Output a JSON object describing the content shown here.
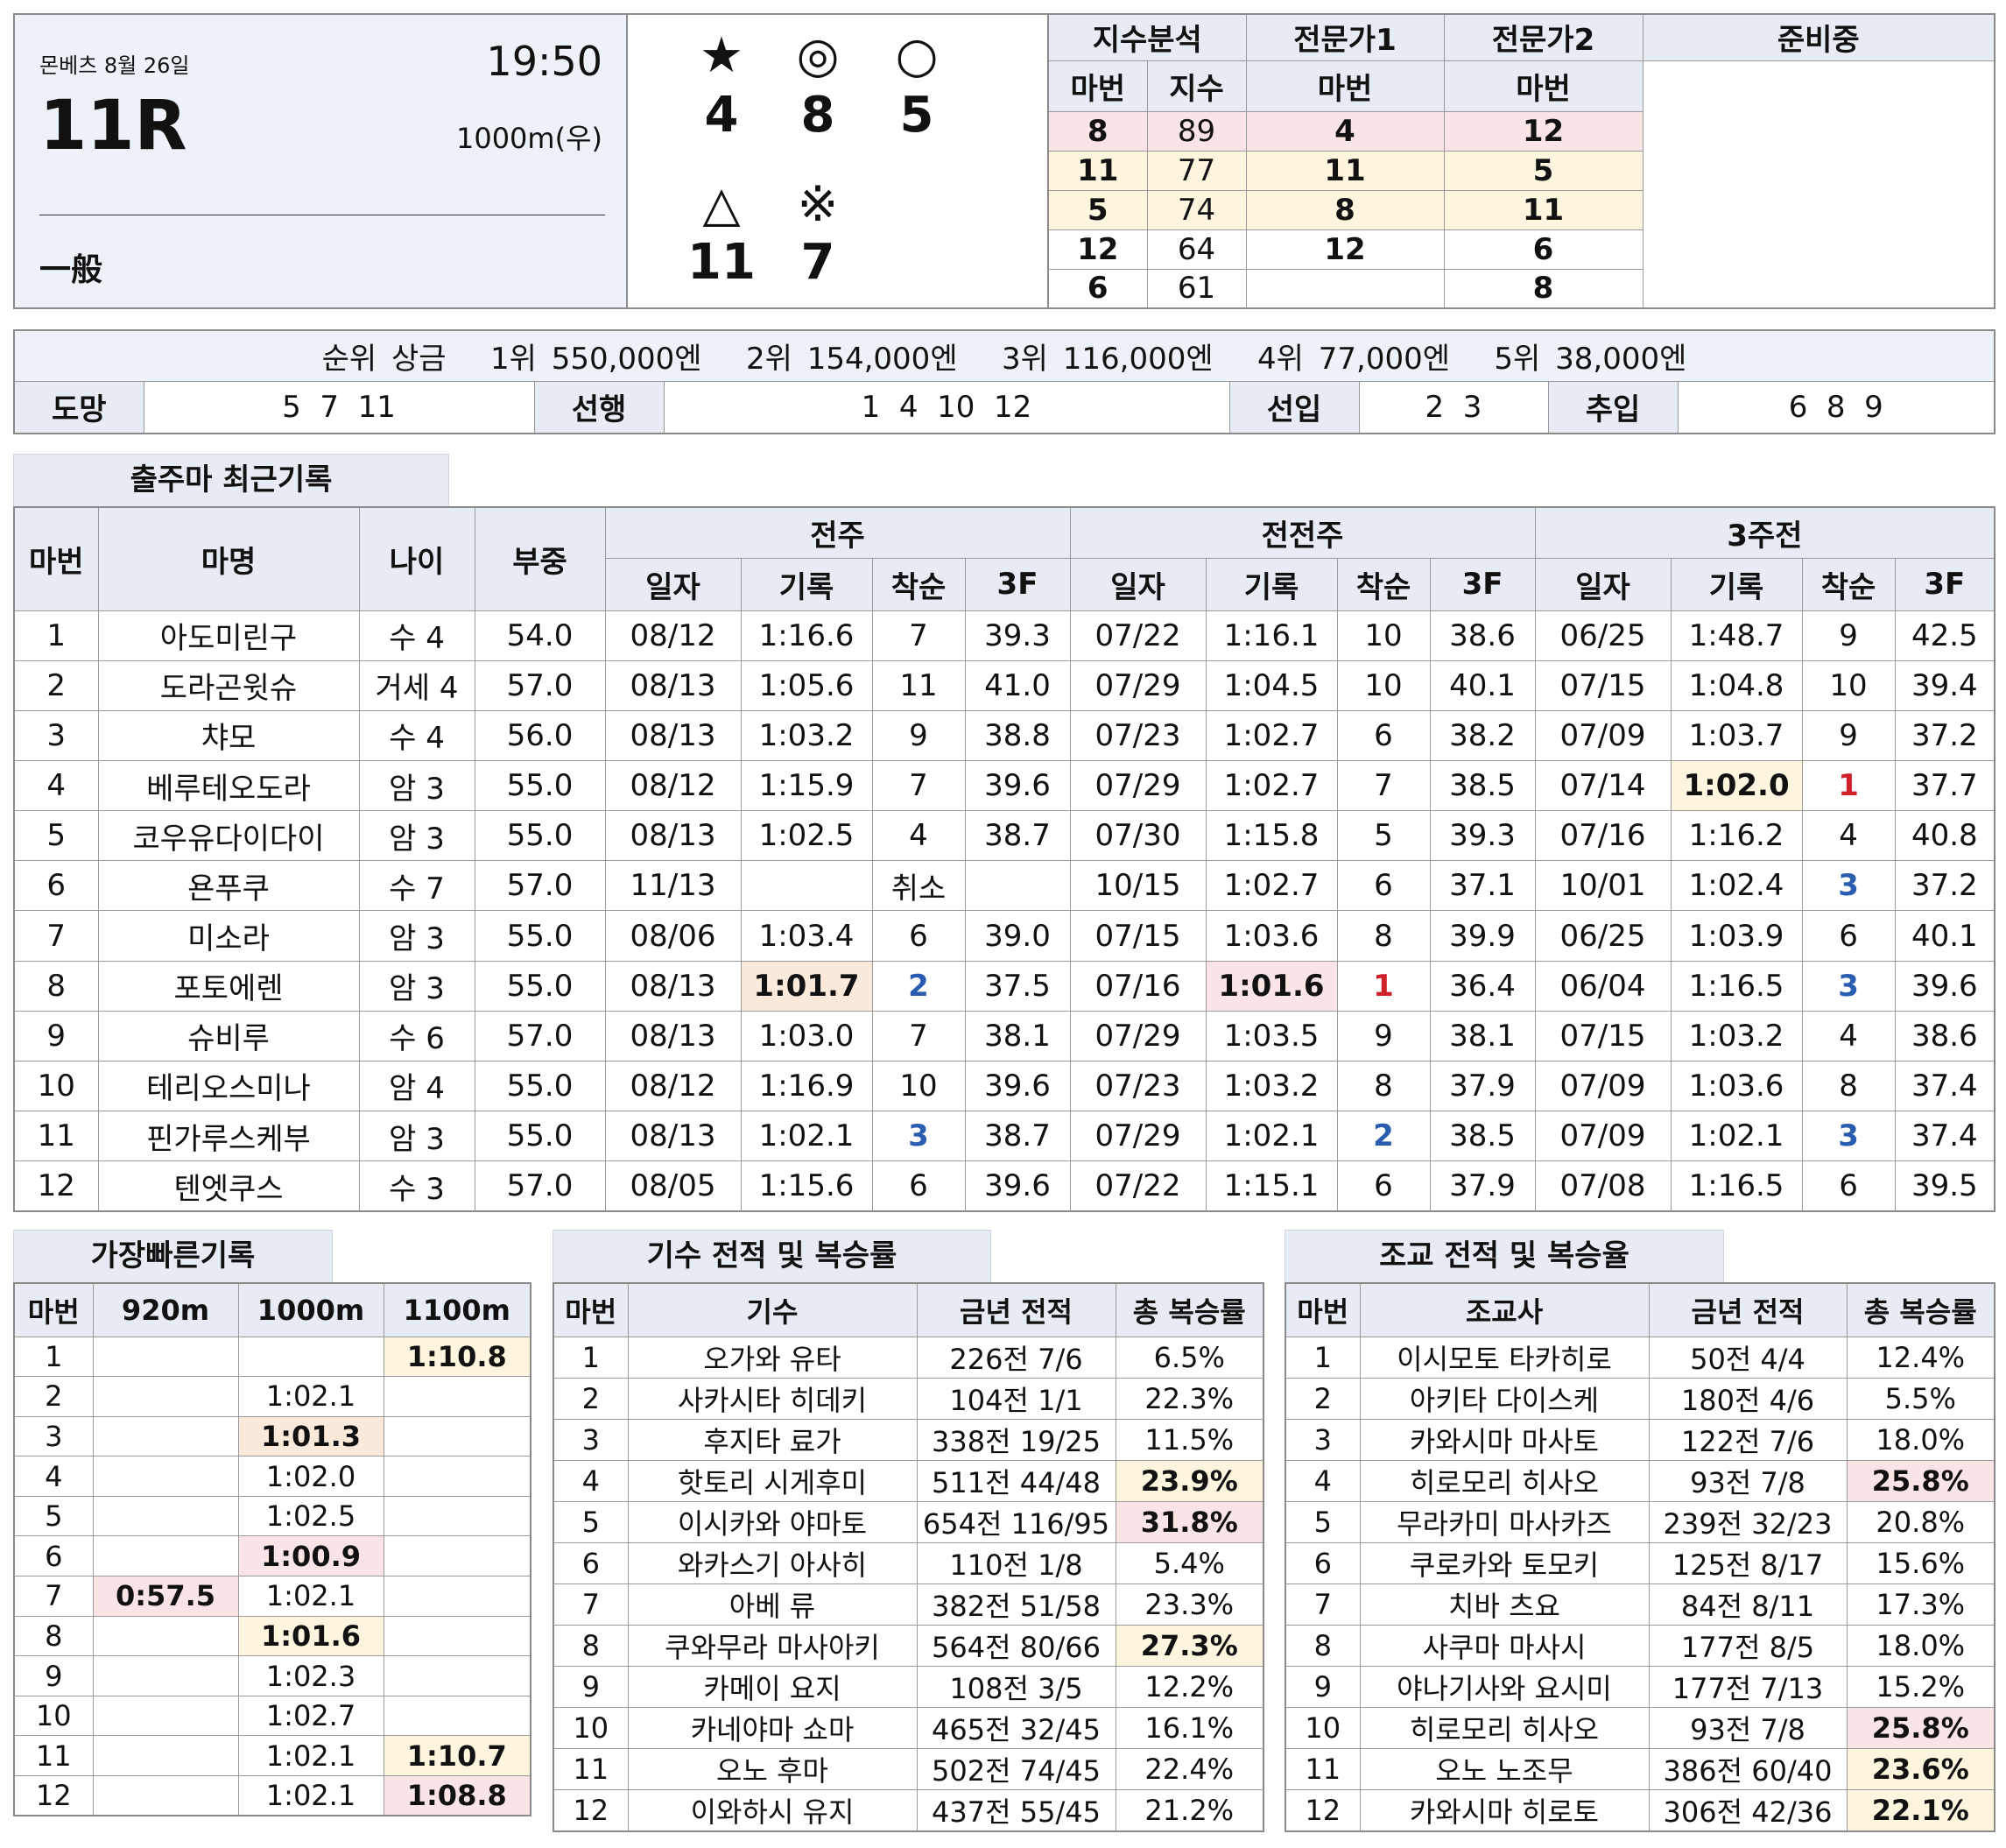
{
  "race": {
    "venue_date": "몬베츠 8월 26일",
    "time": "19:50",
    "number": "11R",
    "distance": "1000m(우)",
    "class": "一般"
  },
  "marks": [
    {
      "symbol": "★",
      "horse": "4"
    },
    {
      "symbol": "◎",
      "horse": "8"
    },
    {
      "symbol": "○",
      "horse": "5"
    },
    {
      "symbol": "△",
      "horse": "11"
    },
    {
      "symbol": "※",
      "horse": "7"
    }
  ],
  "analysis": {
    "headers": [
      "지수분석",
      "전문가1",
      "전문가2",
      "준비중"
    ],
    "sub_headers": [
      "마번",
      "지수",
      "마번",
      "마번"
    ],
    "rows": [
      [
        "8",
        "89",
        "4",
        "12"
      ],
      [
        "11",
        "77",
        "11",
        "5"
      ],
      [
        "5",
        "74",
        "8",
        "11"
      ],
      [
        "12",
        "64",
        "12",
        "6"
      ],
      [
        "6",
        "61",
        "",
        "8"
      ]
    ]
  },
  "prize": {
    "text": "순위 상금   1위 550,000엔   2위 154,000엔   3위 116,000엔   4위 77,000엔   5위 38,000엔"
  },
  "styles": [
    {
      "label": "도망",
      "value": "5  7  11"
    },
    {
      "label": "선행",
      "value": "1  4  10  12"
    },
    {
      "label": "선입",
      "value": "2  3"
    },
    {
      "label": "추입",
      "value": "6  8  9"
    }
  ],
  "recent": {
    "title": "출주마 최근기록",
    "headers": [
      "마번",
      "마명",
      "나이",
      "부중"
    ],
    "groups": [
      "전주",
      "전전주",
      "3주전"
    ],
    "sub_headers": [
      "일자",
      "기록",
      "착순",
      "3F"
    ],
    "rows": [
      [
        "1",
        "아도미린구",
        "수 4",
        "54.0",
        "08/12",
        "1:16.6",
        "7",
        "39.3",
        "07/22",
        "1:16.1",
        "10",
        "38.6",
        "06/25",
        "1:48.7",
        "9",
        "42.5"
      ],
      [
        "2",
        "도라곤윗슈",
        "거세 4",
        "57.0",
        "08/13",
        "1:05.6",
        "11",
        "41.0",
        "07/29",
        "1:04.5",
        "10",
        "40.1",
        "07/15",
        "1:04.8",
        "10",
        "39.4"
      ],
      [
        "3",
        "챠모",
        "수 4",
        "56.0",
        "08/13",
        "1:03.2",
        "9",
        "38.8",
        "07/23",
        "1:02.7",
        "6",
        "38.2",
        "07/09",
        "1:03.7",
        "9",
        "37.2"
      ],
      [
        "4",
        "베루테오도라",
        "암 3",
        "55.0",
        "08/12",
        "1:15.9",
        "7",
        "39.6",
        "07/29",
        "1:02.7",
        "7",
        "38.5",
        "07/14",
        "1:02.0",
        "1",
        "37.7"
      ],
      [
        "5",
        "코우유다이다이",
        "암 3",
        "55.0",
        "08/13",
        "1:02.5",
        "4",
        "38.7",
        "07/30",
        "1:15.8",
        "5",
        "39.3",
        "07/16",
        "1:16.2",
        "4",
        "40.8"
      ],
      [
        "6",
        "욘푸쿠",
        "수 7",
        "57.0",
        "11/13",
        "",
        "취소",
        "",
        "10/15",
        "1:02.7",
        "6",
        "37.1",
        "10/01",
        "1:02.4",
        "3",
        "37.2"
      ],
      [
        "7",
        "미소라",
        "암 3",
        "55.0",
        "08/06",
        "1:03.4",
        "6",
        "39.0",
        "07/15",
        "1:03.6",
        "8",
        "39.9",
        "06/25",
        "1:03.9",
        "6",
        "40.1"
      ],
      [
        "8",
        "포토에렌",
        "암 3",
        "55.0",
        "08/13",
        "1:01.7",
        "2",
        "37.5",
        "07/16",
        "1:01.6",
        "1",
        "36.4",
        "06/04",
        "1:16.5",
        "3",
        "39.6"
      ],
      [
        "9",
        "슈비루",
        "수 6",
        "57.0",
        "08/13",
        "1:03.0",
        "7",
        "38.1",
        "07/29",
        "1:03.5",
        "9",
        "38.1",
        "07/15",
        "1:03.2",
        "4",
        "38.6"
      ],
      [
        "10",
        "테리오스미나",
        "암 4",
        "55.0",
        "08/12",
        "1:16.9",
        "10",
        "39.6",
        "07/23",
        "1:03.2",
        "8",
        "37.9",
        "07/09",
        "1:03.6",
        "8",
        "37.4"
      ],
      [
        "11",
        "핀가루스케부",
        "암 3",
        "55.0",
        "08/13",
        "1:02.1",
        "3",
        "38.7",
        "07/29",
        "1:02.1",
        "2",
        "38.5",
        "07/09",
        "1:02.1",
        "3",
        "37.4"
      ],
      [
        "12",
        "텐엣쿠스",
        "수 3",
        "57.0",
        "08/05",
        "1:15.6",
        "6",
        "39.6",
        "07/22",
        "1:15.1",
        "6",
        "37.9",
        "07/08",
        "1:16.5",
        "6",
        "39.5"
      ]
    ]
  },
  "fastest": {
    "title": "가장빠른기록",
    "headers": [
      "마번",
      "920m",
      "1000m",
      "1100m"
    ],
    "rows": [
      [
        "1",
        "",
        "",
        "1:10.8"
      ],
      [
        "2",
        "",
        "1:02.1",
        ""
      ],
      [
        "3",
        "",
        "1:01.3",
        ""
      ],
      [
        "4",
        "",
        "1:02.0",
        ""
      ],
      [
        "5",
        "",
        "1:02.5",
        ""
      ],
      [
        "6",
        "",
        "1:00.9",
        ""
      ],
      [
        "7",
        "0:57.5",
        "1:02.1",
        ""
      ],
      [
        "8",
        "",
        "1:01.6",
        ""
      ],
      [
        "9",
        "",
        "1:02.3",
        ""
      ],
      [
        "10",
        "",
        "1:02.7",
        ""
      ],
      [
        "11",
        "",
        "1:02.1",
        "1:10.7"
      ],
      [
        "12",
        "",
        "1:02.1",
        "1:08.8"
      ]
    ]
  },
  "jockey": {
    "title": "기수 전적 및 복승률",
    "headers": [
      "마번",
      "기수",
      "금년 전적",
      "총 복승률"
    ],
    "rows": [
      [
        "1",
        "오가와 유타",
        "226전 7/6",
        "6.5%"
      ],
      [
        "2",
        "사카시타 히데키",
        "104전 1/1",
        "22.3%"
      ],
      [
        "3",
        "후지타 료가",
        "338전 19/25",
        "11.5%"
      ],
      [
        "4",
        "핫토리 시게후미",
        "511전 44/48",
        "23.9%"
      ],
      [
        "5",
        "이시카와 야마토",
        "654전 116/95",
        "31.8%"
      ],
      [
        "6",
        "와카스기 아사히",
        "110전 1/8",
        "5.4%"
      ],
      [
        "7",
        "아베 류",
        "382전 51/58",
        "23.3%"
      ],
      [
        "8",
        "쿠와무라 마사아키",
        "564전 80/66",
        "27.3%"
      ],
      [
        "9",
        "카메이 요지",
        "108전 3/5",
        "12.2%"
      ],
      [
        "10",
        "카네야마 쇼마",
        "465전 32/45",
        "16.1%"
      ],
      [
        "11",
        "오노 후마",
        "502전 74/45",
        "22.4%"
      ],
      [
        "12",
        "이와하시 유지",
        "437전 55/45",
        "21.2%"
      ]
    ]
  },
  "trainer": {
    "title": "조교 전적 및 복승율",
    "headers": [
      "마번",
      "조교사",
      "금년 전적",
      "총 복승률"
    ],
    "rows": [
      [
        "1",
        "이시모토 타카히로",
        "50전 4/4",
        "12.4%"
      ],
      [
        "2",
        "아키타 다이스케",
        "180전 4/6",
        "5.5%"
      ],
      [
        "3",
        "카와시마 마사토",
        "122전 7/6",
        "18.0%"
      ],
      [
        "4",
        "히로모리 히사오",
        "93전 7/8",
        "25.8%"
      ],
      [
        "5",
        "무라카미 마사카즈",
        "239전 32/23",
        "20.8%"
      ],
      [
        "6",
        "쿠로카와 토모키",
        "125전 8/17",
        "15.6%"
      ],
      [
        "7",
        "치바 츠요",
        "84전 8/11",
        "17.3%"
      ],
      [
        "8",
        "사쿠마 마사시",
        "177전 8/5",
        "18.0%"
      ],
      [
        "9",
        "야나기사와 요시미",
        "177전 7/13",
        "15.2%"
      ],
      [
        "10",
        "히로모리 히사오",
        "93전 7/8",
        "25.8%"
      ],
      [
        "11",
        "오노 노조무",
        "386전 60/40",
        "23.6%"
      ],
      [
        "12",
        "카와시마 히로토",
        "306전 42/36",
        "22.1%"
      ]
    ]
  }
}
